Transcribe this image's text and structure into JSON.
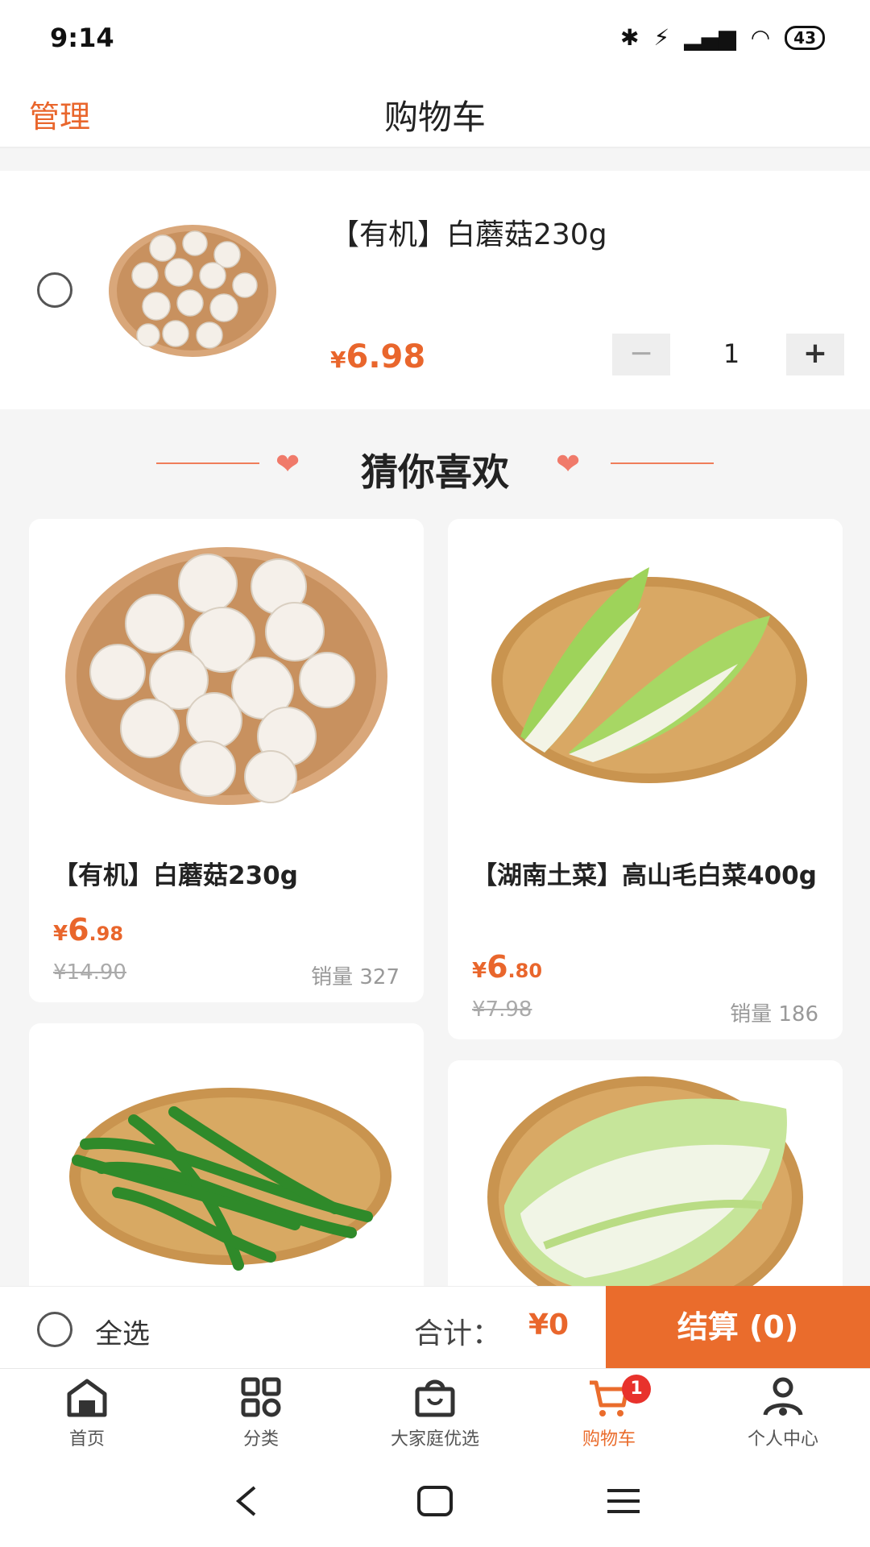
{
  "status_bar": {
    "time": "9:14",
    "icons": [
      "bluetooth-icon",
      "vibrate-off-icon",
      "signal-hd-icon",
      "wifi-icon",
      "battery-icon"
    ],
    "battery": "43"
  },
  "nav": {
    "manage": "管理",
    "title": "购物车"
  },
  "cart": {
    "items": [
      {
        "name": "【有机】白蘑菇230g",
        "price_symbol": "¥",
        "price": "6.98",
        "quantity": "1",
        "minus_label": "−",
        "plus_label": "+"
      }
    ]
  },
  "recommend": {
    "title": "猜你喜欢",
    "heart": "❤",
    "products": [
      {
        "name": "【有机】白蘑菇230g",
        "price_symbol": "¥",
        "price_int": "6",
        "price_dec": ".98",
        "original_price": "¥14.90",
        "sales_label": "销量",
        "sales": "327"
      },
      {
        "name": "【湖南土菜】高山毛白菜400g",
        "price_symbol": "¥",
        "price_int": "6",
        "price_dec": ".80",
        "original_price": "¥7.98",
        "sales_label": "销量",
        "sales": "186"
      },
      {
        "name": "green-peppers-image"
      },
      {
        "name": "napa-cabbage-image"
      }
    ]
  },
  "footer": {
    "select_all": "全选",
    "total_label": "合计：",
    "total_value": "¥0",
    "checkout": "结算 (0)"
  },
  "tabbar": {
    "tabs": [
      {
        "label": "首页",
        "icon": "home-icon"
      },
      {
        "label": "分类",
        "icon": "grid-icon"
      },
      {
        "label": "大家庭优选",
        "icon": "shopping-bag-icon"
      },
      {
        "label": "购物车",
        "icon": "cart-icon",
        "badge": "1",
        "active": true
      },
      {
        "label": "个人中心",
        "icon": "user-icon"
      }
    ]
  },
  "colors": {
    "accent": "#ea6c2c",
    "price": "#e9662c",
    "badge": "#e8322c"
  }
}
